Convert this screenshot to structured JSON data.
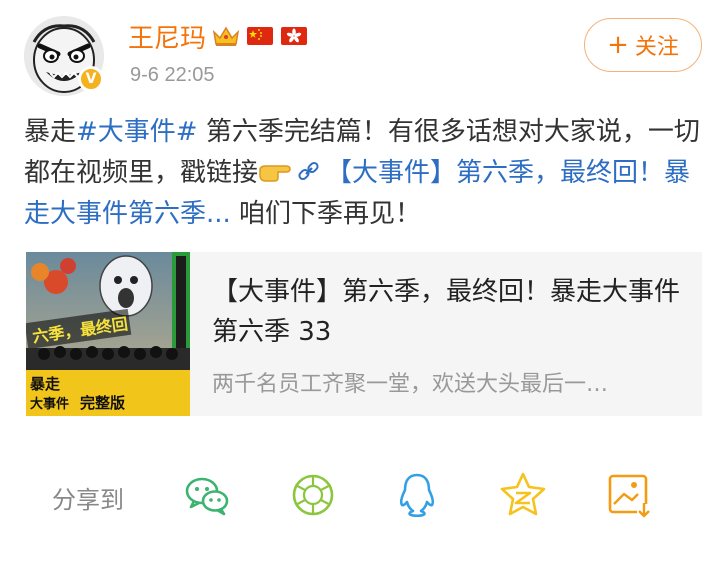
{
  "user": {
    "name": "王尼玛",
    "verified_badge": "V",
    "time": "9-6 22:05",
    "icons": [
      "crown-icon",
      "china-flag-icon",
      "hong-kong-flag-icon"
    ]
  },
  "follow_button": {
    "plus": "+",
    "label": "关注"
  },
  "post": {
    "prefix": "暴走",
    "hashtag": "#大事件#",
    "body": " 第六季完结篇！有很多话想对大家说，一切都在视频里，戳链接",
    "link_text": "【大事件】第六季，最终回！暴走大事件第六季...",
    "suffix": " 咱们下季再见！"
  },
  "card": {
    "title": "【大事件】第六季，最终回！暴走大事件第六季 33",
    "description": "两千名员工齐聚一堂，欢送大头最后一…",
    "thumb_text_top": "六季，最终回",
    "thumb_brand_line1": "暴走",
    "thumb_brand_line2": "大事件",
    "thumb_tag": "完整版"
  },
  "share": {
    "label": "分享到",
    "targets": [
      "wechat-icon",
      "moments-icon",
      "qq-icon",
      "qzone-icon",
      "save-image-icon"
    ]
  },
  "colors": {
    "name": "#f4730a",
    "link": "#2d6ec4",
    "wechat": "#3cb371",
    "moments": "#8cc63f",
    "qq": "#33a0e6",
    "qzone": "#f6c21b",
    "save": "#f39c12"
  }
}
